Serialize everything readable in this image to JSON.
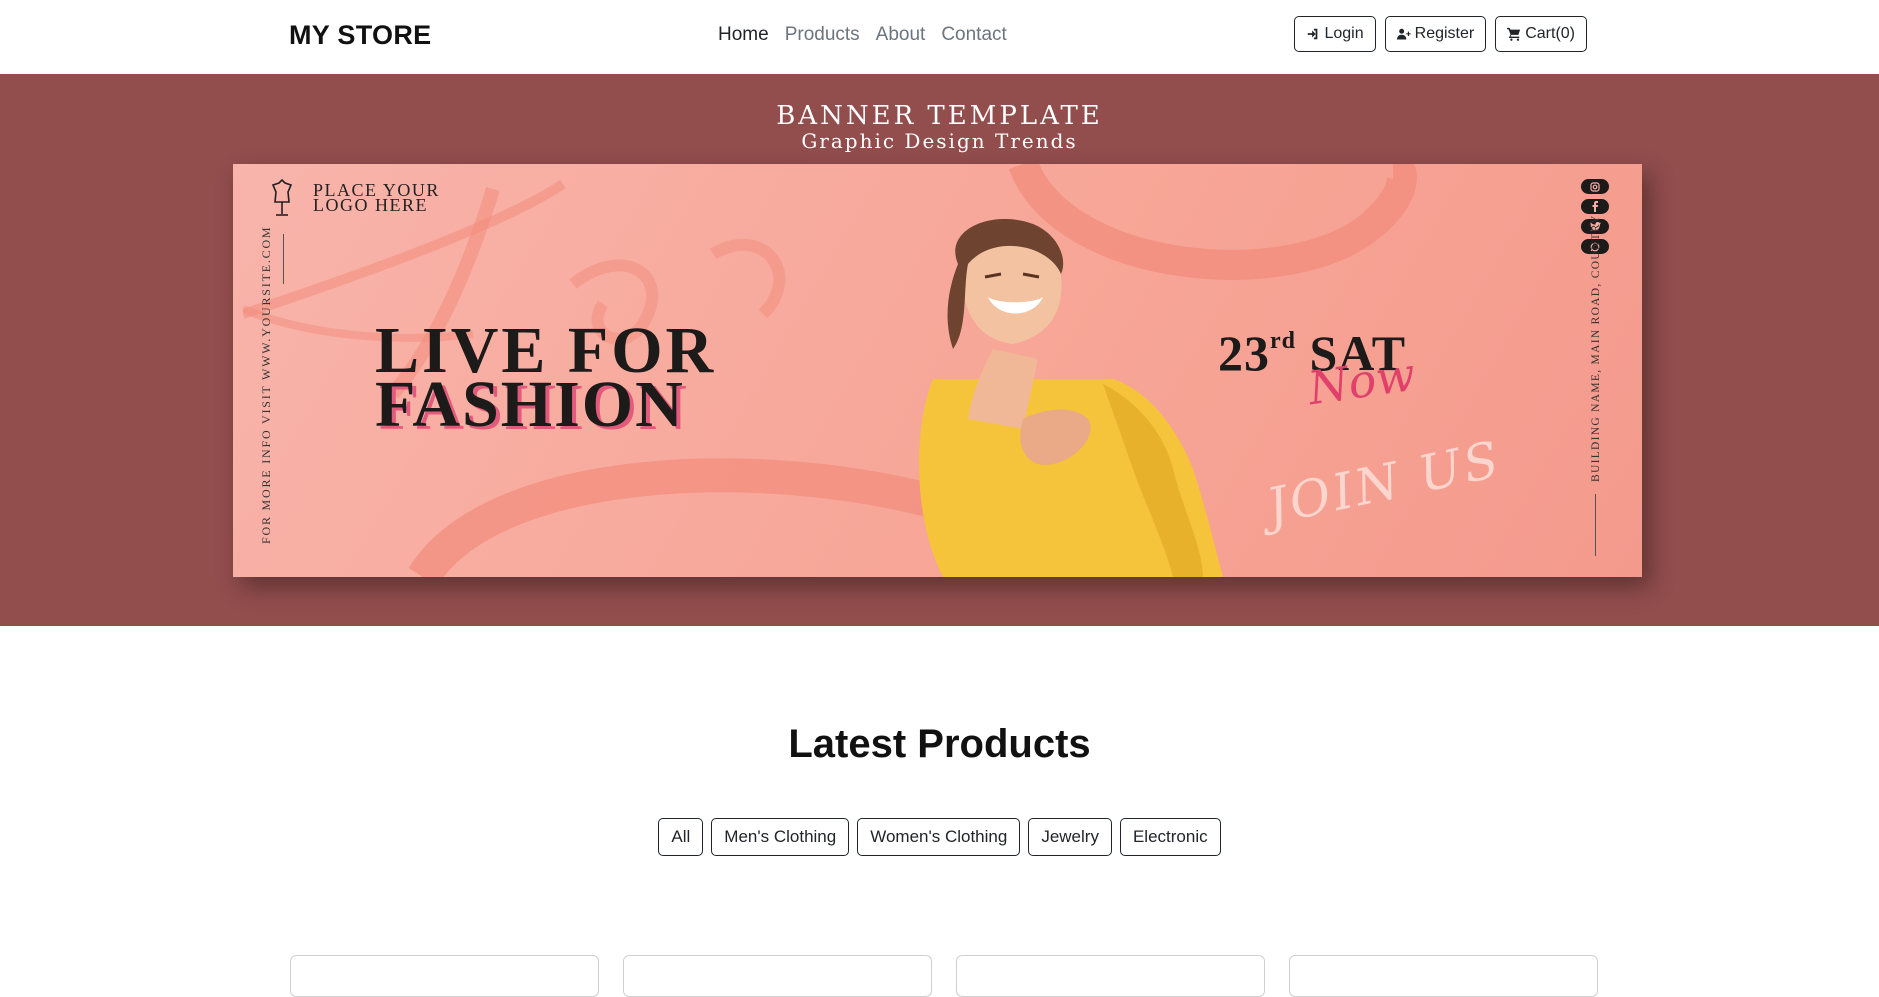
{
  "navbar": {
    "brand": "MY STORE",
    "links": [
      "Home",
      "Products",
      "About",
      "Contact"
    ],
    "buttons": {
      "login": "Login",
      "register": "Register",
      "cart": "Cart(0)"
    }
  },
  "hero": {
    "title": "BANNER TEMPLATE",
    "subtitle": "Graphic Design Trends",
    "banner": {
      "logo_line1": "PLACE YOUR",
      "logo_line2": "LOGO HERE",
      "side_left": "FOR MORE INFO VISIT WWW.YOURSITE.COM",
      "headline_line1": "LIVE FOR",
      "headline_line2": "FASHION",
      "date_num": "23",
      "date_suffix": "rd",
      "date_day": "SAT",
      "now": "Now",
      "join": "JOIN US",
      "side_right": "BUILDING NAME, MAIN ROAD, COUNTRY",
      "socials": [
        "instagram-icon",
        "facebook-icon",
        "twitter-icon",
        "whatsapp-icon"
      ]
    },
    "bg_color": "#924d4d"
  },
  "products": {
    "title": "Latest Products",
    "filters": [
      "All",
      "Men's Clothing",
      "Women's Clothing",
      "Jewelry",
      "Electronic"
    ]
  }
}
